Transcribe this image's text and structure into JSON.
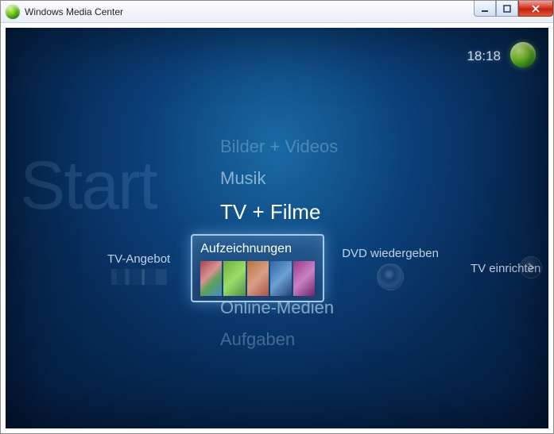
{
  "window": {
    "title": "Windows Media Center"
  },
  "header": {
    "clock": "18:18"
  },
  "background_label": "Start",
  "vertical_menu": {
    "items": [
      {
        "label": "Bilder + Videos",
        "state": "far"
      },
      {
        "label": "Musik",
        "state": "near"
      },
      {
        "label": "TV + Filme",
        "state": "active"
      },
      {
        "label": "Online-Medien",
        "state": "near"
      },
      {
        "label": "Aufgaben",
        "state": "far"
      }
    ]
  },
  "horizontal_row": {
    "items": [
      {
        "label": "TV-Angebot",
        "kind": "tv-guide"
      },
      {
        "label": "Aufzeichnungen",
        "kind": "recordings",
        "selected": true
      },
      {
        "label": "DVD wiedergeben",
        "kind": "dvd"
      },
      {
        "label": "TV einrichten",
        "kind": "tv-setup"
      }
    ]
  }
}
